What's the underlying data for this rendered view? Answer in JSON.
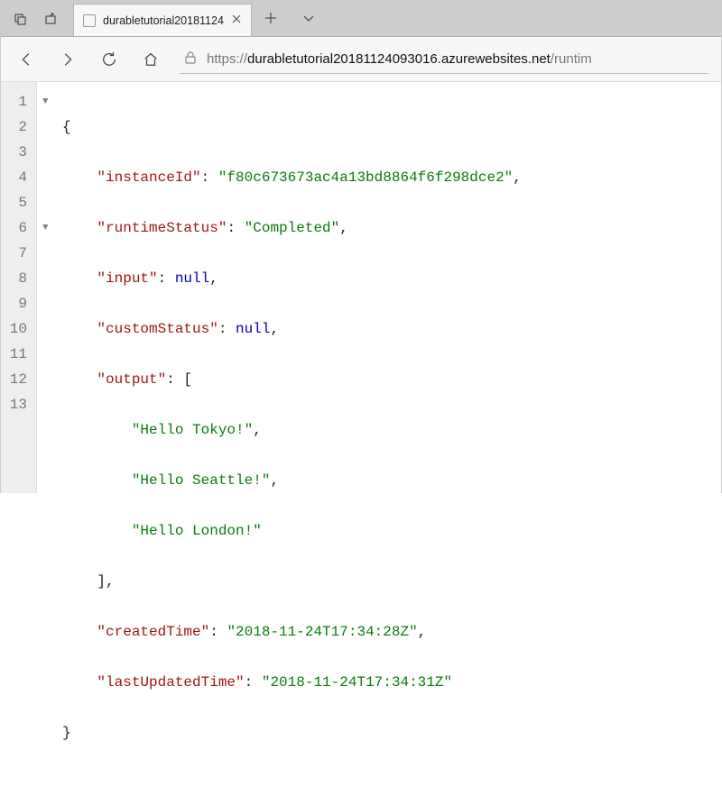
{
  "window": {
    "tab_title": "durabletutorial20181124"
  },
  "address": {
    "scheme": "https://",
    "host": "durabletutorial20181124093016.azurewebsites.net",
    "path": "/runtim"
  },
  "json_response": {
    "instanceId": "f80c673673ac4a13bd8864f6f298dce2",
    "runtimeStatus": "Completed",
    "input": null,
    "customStatus": null,
    "output": [
      "Hello Tokyo!",
      "Hello Seattle!",
      "Hello London!"
    ],
    "createdTime": "2018-11-24T17:34:28Z",
    "lastUpdatedTime": "2018-11-24T17:34:31Z"
  },
  "code_lines": {
    "l1": "{",
    "l2a": "\"instanceId\"",
    "l2b": "\"f80c673673ac4a13bd8864f6f298dce2\"",
    "l3a": "\"runtimeStatus\"",
    "l3b": "\"Completed\"",
    "l4a": "\"input\"",
    "l4b": "null",
    "l5a": "\"customStatus\"",
    "l5b": "null",
    "l6a": "\"output\"",
    "l7": "\"Hello Tokyo!\"",
    "l8": "\"Hello Seattle!\"",
    "l9": "\"Hello London!\"",
    "l11a": "\"createdTime\"",
    "l11b": "\"2018-11-24T17:34:28Z\"",
    "l12a": "\"lastUpdatedTime\"",
    "l12b": "\"2018-11-24T17:34:31Z\"",
    "l13": "}"
  },
  "gutter": [
    "1",
    "2",
    "3",
    "4",
    "5",
    "6",
    "7",
    "8",
    "9",
    "10",
    "11",
    "12",
    "13"
  ]
}
